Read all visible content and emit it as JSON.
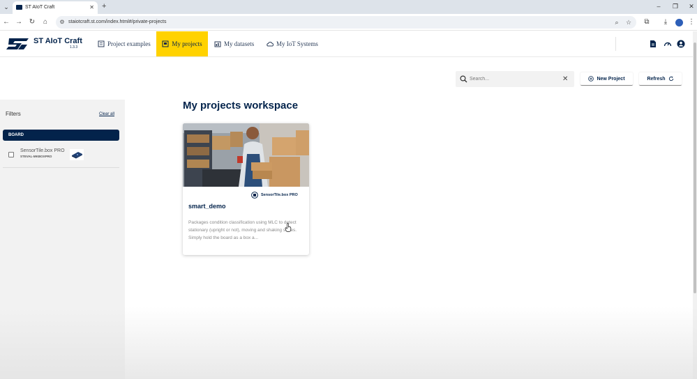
{
  "browser": {
    "tab_title": "ST AIoT Craft",
    "tab_close": "✕",
    "new_tab": "+",
    "url": "staiotcraft.st.com/index.html#/private-projects",
    "window_controls": [
      "–",
      "❐",
      "✕"
    ]
  },
  "app": {
    "brand_name": "ST AIoT Craft",
    "version": "1.3.3",
    "nav": [
      {
        "label": "Project examples",
        "icon": "book-icon"
      },
      {
        "label": "My projects",
        "icon": "folder-icon",
        "active": true
      },
      {
        "label": "My datasets",
        "icon": "dataset-icon"
      },
      {
        "label": "My IoT Systems",
        "icon": "cloud-icon"
      }
    ],
    "accent_color": "#ffd200",
    "brand_color": "#03234b"
  },
  "sidebar": {
    "filters_label": "Filters",
    "clear_all": "Clear all",
    "board_header": "BOARD",
    "boards": [
      {
        "name": "SensorTile.box PRO",
        "code": "STEVAL-MKBOXPRO",
        "checked": false
      }
    ]
  },
  "toolbar": {
    "search_placeholder": "Search...",
    "search_value": "",
    "clear_icon": "✕",
    "new_project": "New Project",
    "refresh": "Refresh"
  },
  "main": {
    "page_title": "My projects workspace",
    "projects": [
      {
        "board": "SensorTile.box PRO",
        "title": "smart_demo",
        "description": "Packages condition classification using MLC to detect stationary (upright or not), moving and shaking states. Simply hold the board as a box a..."
      }
    ]
  }
}
